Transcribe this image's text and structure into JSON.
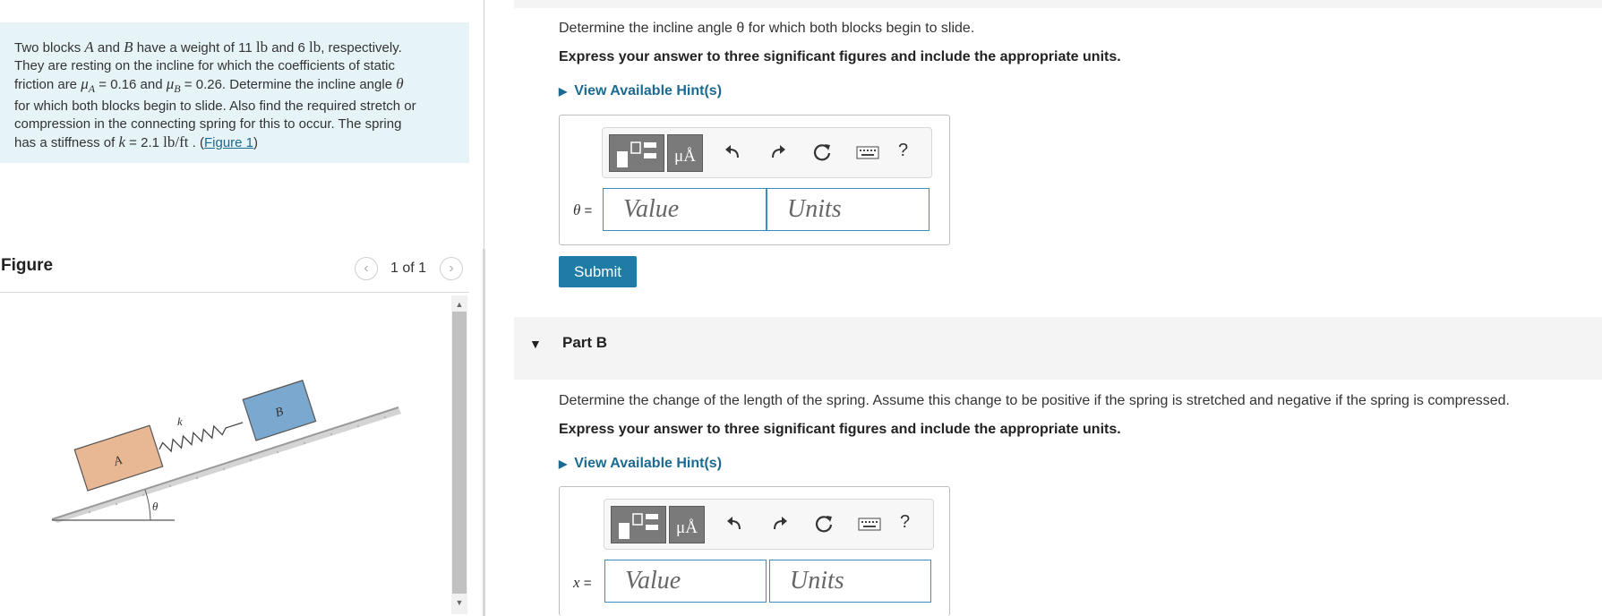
{
  "problem": {
    "intro": "Two blocks ",
    "A": "A",
    "and": " and ",
    "B": "B",
    "weights1": " have a weight of 11 ",
    "unit_lb": "lb",
    "weights2": " and 6 ",
    "respectively": ", respectively.",
    "line2": "They are resting on the incline for which the coefficients of static",
    "friction_are": "friction are ",
    "muA": "μ",
    "subA": "A",
    "muA_val": " = 0.16 and ",
    "muB": "μ",
    "subB": "B",
    "muB_val": " = 0.26. Determine the incline angle ",
    "theta": "θ",
    "line4": "for which both blocks begin to slide. Also find the required stretch or",
    "line5": "compression in the connecting spring for this to occur. The spring",
    "line6a": "has a stiffness of ",
    "k": "k",
    "k_val": " = 2.1 ",
    "k_unit": "lb/ft",
    "period": " . (",
    "figure_link": "Figure 1",
    "close": ")"
  },
  "figure": {
    "title": "Figure",
    "pager": "1 of 1",
    "prev_icon": "chevron-left-icon",
    "next_icon": "chevron-right-icon",
    "label_A": "A",
    "label_B": "B",
    "label_k": "k",
    "label_theta": "θ"
  },
  "partA": {
    "question": "Determine the incline angle θ for which both blocks begin to slide.",
    "instruction": "Express your answer to three significant figures and include the appropriate units.",
    "hint": "View Available Hint(s)",
    "var_label": "θ",
    "equals": " =",
    "value_placeholder": "Value",
    "units_placeholder": "Units",
    "submit": "Submit"
  },
  "partB": {
    "title": "Part B",
    "question": "Determine the change of the length of  the spring. Assume this change to be positive if the spring is stretched and negative if the spring is compressed.",
    "instruction": "Express your answer to three significant figures and include the appropriate units.",
    "hint": "View Available Hint(s)",
    "var_label": "x",
    "equals": " =",
    "value_placeholder": "Value",
    "units_placeholder": "Units"
  },
  "toolbar": {
    "units_button": "μÅ",
    "help": "?",
    "icons": [
      "templates-icon",
      "units-icon",
      "undo-icon",
      "redo-icon",
      "reset-icon",
      "keyboard-icon",
      "help-icon"
    ]
  },
  "colors": {
    "accent": "#1e7ca6",
    "link": "#1b6a92",
    "problem_bg": "#e6f4f7",
    "block_A": "#e8b894",
    "block_B": "#7aa8cf"
  }
}
